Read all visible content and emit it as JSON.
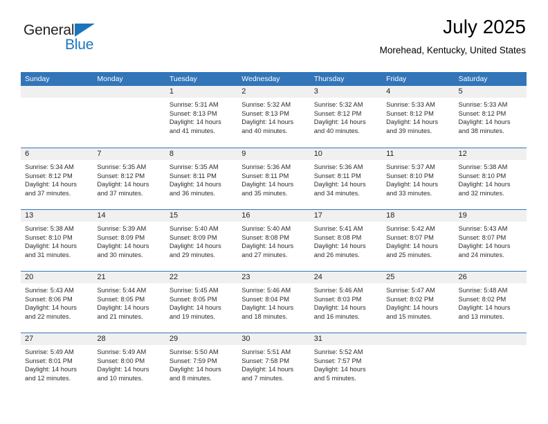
{
  "brand": {
    "name_part1": "General",
    "name_part2": "Blue",
    "accent_color": "#1b75bb"
  },
  "header": {
    "title": "July 2025",
    "subtitle": "Morehead, Kentucky, United States"
  },
  "theme": {
    "header_blue": "#3275b9",
    "day_band_gray": "#f0f0f0",
    "text_color": "#2b2b2b"
  },
  "weekdays": [
    "Sunday",
    "Monday",
    "Tuesday",
    "Wednesday",
    "Thursday",
    "Friday",
    "Saturday"
  ],
  "weeks": [
    [
      {
        "day": "",
        "sunrise": "",
        "sunset": "",
        "daylight_line1": "",
        "daylight_line2": ""
      },
      {
        "day": "",
        "sunrise": "",
        "sunset": "",
        "daylight_line1": "",
        "daylight_line2": ""
      },
      {
        "day": "1",
        "sunrise": "Sunrise: 5:31 AM",
        "sunset": "Sunset: 8:13 PM",
        "daylight_line1": "Daylight: 14 hours",
        "daylight_line2": "and 41 minutes."
      },
      {
        "day": "2",
        "sunrise": "Sunrise: 5:32 AM",
        "sunset": "Sunset: 8:13 PM",
        "daylight_line1": "Daylight: 14 hours",
        "daylight_line2": "and 40 minutes."
      },
      {
        "day": "3",
        "sunrise": "Sunrise: 5:32 AM",
        "sunset": "Sunset: 8:12 PM",
        "daylight_line1": "Daylight: 14 hours",
        "daylight_line2": "and 40 minutes."
      },
      {
        "day": "4",
        "sunrise": "Sunrise: 5:33 AM",
        "sunset": "Sunset: 8:12 PM",
        "daylight_line1": "Daylight: 14 hours",
        "daylight_line2": "and 39 minutes."
      },
      {
        "day": "5",
        "sunrise": "Sunrise: 5:33 AM",
        "sunset": "Sunset: 8:12 PM",
        "daylight_line1": "Daylight: 14 hours",
        "daylight_line2": "and 38 minutes."
      }
    ],
    [
      {
        "day": "6",
        "sunrise": "Sunrise: 5:34 AM",
        "sunset": "Sunset: 8:12 PM",
        "daylight_line1": "Daylight: 14 hours",
        "daylight_line2": "and 37 minutes."
      },
      {
        "day": "7",
        "sunrise": "Sunrise: 5:35 AM",
        "sunset": "Sunset: 8:12 PM",
        "daylight_line1": "Daylight: 14 hours",
        "daylight_line2": "and 37 minutes."
      },
      {
        "day": "8",
        "sunrise": "Sunrise: 5:35 AM",
        "sunset": "Sunset: 8:11 PM",
        "daylight_line1": "Daylight: 14 hours",
        "daylight_line2": "and 36 minutes."
      },
      {
        "day": "9",
        "sunrise": "Sunrise: 5:36 AM",
        "sunset": "Sunset: 8:11 PM",
        "daylight_line1": "Daylight: 14 hours",
        "daylight_line2": "and 35 minutes."
      },
      {
        "day": "10",
        "sunrise": "Sunrise: 5:36 AM",
        "sunset": "Sunset: 8:11 PM",
        "daylight_line1": "Daylight: 14 hours",
        "daylight_line2": "and 34 minutes."
      },
      {
        "day": "11",
        "sunrise": "Sunrise: 5:37 AM",
        "sunset": "Sunset: 8:10 PM",
        "daylight_line1": "Daylight: 14 hours",
        "daylight_line2": "and 33 minutes."
      },
      {
        "day": "12",
        "sunrise": "Sunrise: 5:38 AM",
        "sunset": "Sunset: 8:10 PM",
        "daylight_line1": "Daylight: 14 hours",
        "daylight_line2": "and 32 minutes."
      }
    ],
    [
      {
        "day": "13",
        "sunrise": "Sunrise: 5:38 AM",
        "sunset": "Sunset: 8:10 PM",
        "daylight_line1": "Daylight: 14 hours",
        "daylight_line2": "and 31 minutes."
      },
      {
        "day": "14",
        "sunrise": "Sunrise: 5:39 AM",
        "sunset": "Sunset: 8:09 PM",
        "daylight_line1": "Daylight: 14 hours",
        "daylight_line2": "and 30 minutes."
      },
      {
        "day": "15",
        "sunrise": "Sunrise: 5:40 AM",
        "sunset": "Sunset: 8:09 PM",
        "daylight_line1": "Daylight: 14 hours",
        "daylight_line2": "and 29 minutes."
      },
      {
        "day": "16",
        "sunrise": "Sunrise: 5:40 AM",
        "sunset": "Sunset: 8:08 PM",
        "daylight_line1": "Daylight: 14 hours",
        "daylight_line2": "and 27 minutes."
      },
      {
        "day": "17",
        "sunrise": "Sunrise: 5:41 AM",
        "sunset": "Sunset: 8:08 PM",
        "daylight_line1": "Daylight: 14 hours",
        "daylight_line2": "and 26 minutes."
      },
      {
        "day": "18",
        "sunrise": "Sunrise: 5:42 AM",
        "sunset": "Sunset: 8:07 PM",
        "daylight_line1": "Daylight: 14 hours",
        "daylight_line2": "and 25 minutes."
      },
      {
        "day": "19",
        "sunrise": "Sunrise: 5:43 AM",
        "sunset": "Sunset: 8:07 PM",
        "daylight_line1": "Daylight: 14 hours",
        "daylight_line2": "and 24 minutes."
      }
    ],
    [
      {
        "day": "20",
        "sunrise": "Sunrise: 5:43 AM",
        "sunset": "Sunset: 8:06 PM",
        "daylight_line1": "Daylight: 14 hours",
        "daylight_line2": "and 22 minutes."
      },
      {
        "day": "21",
        "sunrise": "Sunrise: 5:44 AM",
        "sunset": "Sunset: 8:05 PM",
        "daylight_line1": "Daylight: 14 hours",
        "daylight_line2": "and 21 minutes."
      },
      {
        "day": "22",
        "sunrise": "Sunrise: 5:45 AM",
        "sunset": "Sunset: 8:05 PM",
        "daylight_line1": "Daylight: 14 hours",
        "daylight_line2": "and 19 minutes."
      },
      {
        "day": "23",
        "sunrise": "Sunrise: 5:46 AM",
        "sunset": "Sunset: 8:04 PM",
        "daylight_line1": "Daylight: 14 hours",
        "daylight_line2": "and 18 minutes."
      },
      {
        "day": "24",
        "sunrise": "Sunrise: 5:46 AM",
        "sunset": "Sunset: 8:03 PM",
        "daylight_line1": "Daylight: 14 hours",
        "daylight_line2": "and 16 minutes."
      },
      {
        "day": "25",
        "sunrise": "Sunrise: 5:47 AM",
        "sunset": "Sunset: 8:02 PM",
        "daylight_line1": "Daylight: 14 hours",
        "daylight_line2": "and 15 minutes."
      },
      {
        "day": "26",
        "sunrise": "Sunrise: 5:48 AM",
        "sunset": "Sunset: 8:02 PM",
        "daylight_line1": "Daylight: 14 hours",
        "daylight_line2": "and 13 minutes."
      }
    ],
    [
      {
        "day": "27",
        "sunrise": "Sunrise: 5:49 AM",
        "sunset": "Sunset: 8:01 PM",
        "daylight_line1": "Daylight: 14 hours",
        "daylight_line2": "and 12 minutes."
      },
      {
        "day": "28",
        "sunrise": "Sunrise: 5:49 AM",
        "sunset": "Sunset: 8:00 PM",
        "daylight_line1": "Daylight: 14 hours",
        "daylight_line2": "and 10 minutes."
      },
      {
        "day": "29",
        "sunrise": "Sunrise: 5:50 AM",
        "sunset": "Sunset: 7:59 PM",
        "daylight_line1": "Daylight: 14 hours",
        "daylight_line2": "and 8 minutes."
      },
      {
        "day": "30",
        "sunrise": "Sunrise: 5:51 AM",
        "sunset": "Sunset: 7:58 PM",
        "daylight_line1": "Daylight: 14 hours",
        "daylight_line2": "and 7 minutes."
      },
      {
        "day": "31",
        "sunrise": "Sunrise: 5:52 AM",
        "sunset": "Sunset: 7:57 PM",
        "daylight_line1": "Daylight: 14 hours",
        "daylight_line2": "and 5 minutes."
      },
      {
        "day": "",
        "sunrise": "",
        "sunset": "",
        "daylight_line1": "",
        "daylight_line2": ""
      },
      {
        "day": "",
        "sunrise": "",
        "sunset": "",
        "daylight_line1": "",
        "daylight_line2": ""
      }
    ]
  ]
}
